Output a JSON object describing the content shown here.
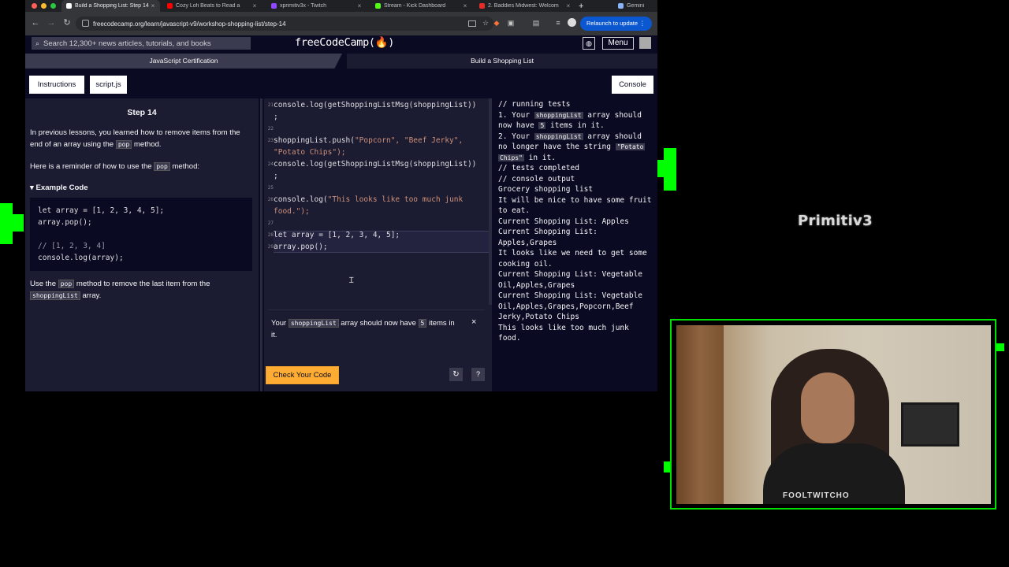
{
  "browser": {
    "tabs": [
      {
        "title": "Build a Shopping List: Step 14",
        "favicon_color": "#ffffff"
      },
      {
        "title": "Cozy Lofi Beats to Read a",
        "favicon_color": "#ff0000"
      },
      {
        "title": "xprimitiv3x - Twitch",
        "favicon_color": "#9146ff"
      },
      {
        "title": "Stream - Kick Dashboard",
        "favicon_color": "#53fc18"
      },
      {
        "title": "2. Baddies Midwest: Welcom",
        "favicon_color": "#e52d27"
      },
      {
        "title": "Gemini",
        "favicon_color": "#8ab4f8"
      }
    ],
    "close_glyph": "×",
    "new_tab": "+",
    "url": "freecodecamp.org/learn/javascript-v9/workshop-shopping-list/step-14",
    "relaunch_label": "Relaunch to update",
    "back_glyph": "←",
    "forward_glyph": "→",
    "reload_glyph": "↻"
  },
  "header": {
    "search_placeholder": "Search 12,300+ news articles, tutorials, and books",
    "logo": "freeCodeCamp(🔥)",
    "menu_label": "Menu"
  },
  "breadcrumb": {
    "left": "JavaScript Certification",
    "right": "Build a Shopping List"
  },
  "pane_tabs": {
    "instructions": "Instructions",
    "script": "script.js",
    "console": "Console"
  },
  "lesson": {
    "step_title": "Step 14",
    "p1_before": "In previous lessons, you learned how to remove items from the end of an array using the ",
    "p1_code": "pop",
    "p1_after": " method.",
    "p2_before": "Here is a reminder of how to use the ",
    "p2_code": "pop",
    "p2_after": " method:",
    "example_summary": "▾ Example Code",
    "example_lines": [
      "let array = [1, 2, 3, 4, 5];",
      "array.pop();",
      "",
      "// [1, 2, 3, 4]",
      "console.log(array);"
    ],
    "p3_before": "Use the ",
    "p3_code": "pop",
    "p3_mid": " method to remove the last item from the ",
    "p3_code2": "shoppingList",
    "p3_after": " array."
  },
  "editor": {
    "line_numbers": [
      "21",
      "22",
      "23",
      "24",
      "25",
      "26",
      "27",
      "28",
      "29"
    ],
    "lines": [
      "console.log(getShoppingListMsg(shoppingList))",
      ";",
      "shoppingList.push(",
      "\"Popcorn\", \"Beef Jerky\",",
      "\"Potato Chips\");",
      "console.log(getShoppingListMsg(shoppingList))",
      ";",
      "console.log(",
      "\"This looks like too much junk",
      "food.\");",
      "let array = [1, 2, 3, 4, 5];",
      "array.pop();"
    ]
  },
  "test": {
    "text_before": "Your ",
    "code1": "shoppingList",
    "text_mid": " array should now have ",
    "code2": "5",
    "text_after": " items in it.",
    "close_glyph": "×",
    "check_label": "Check Your Code",
    "reset_glyph": "↻",
    "help_glyph": "?"
  },
  "console": {
    "lines": [
      "// running tests",
      "1. Your ",
      "shoppingList",
      " array should",
      "now have ",
      "5",
      " items in it.",
      "2. Your ",
      "shoppingList",
      " array should",
      "no longer have the string ",
      "\"Potato",
      "Chips\"",
      " in it.",
      "// tests completed",
      "// console output",
      "Grocery shopping list",
      "It will be nice to have some fruit",
      "to eat.",
      "Current Shopping List: Apples",
      "Current Shopping List:",
      "Apples,Grapes",
      "It looks like we need to get some",
      "cooking oil.",
      "Current Shopping List: Vegetable",
      "Oil,Apples,Grapes",
      "Current Shopping List: Vegetable",
      "Oil,Apples,Grapes,Popcorn,Beef",
      "Jerky,Potato Chips",
      "This looks like too much junk",
      "food."
    ]
  },
  "overlay": {
    "channel_logo": "Primitiv3",
    "shirt_text": "FOOLTWITCHO"
  },
  "colors": {
    "fcc_bg": "#0a0a23",
    "panel_bg": "#1b1b32",
    "check_button": "#feac32",
    "overlay_green": "#00ff00"
  }
}
